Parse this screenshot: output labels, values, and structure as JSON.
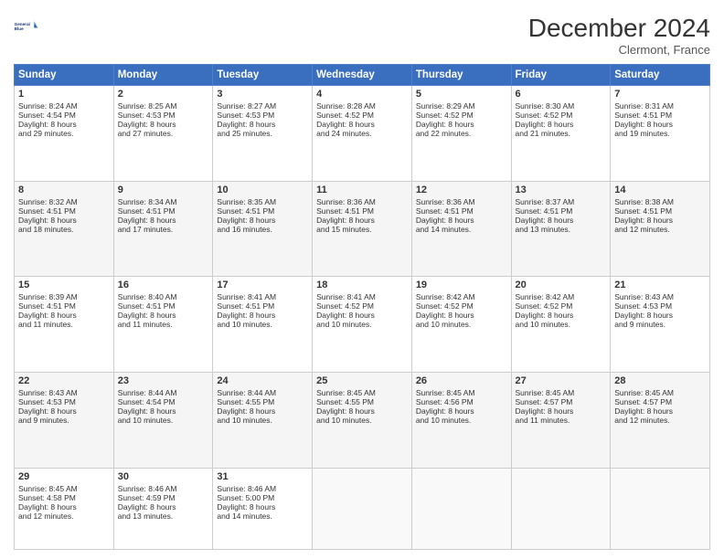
{
  "header": {
    "logo_line1": "General",
    "logo_line2": "Blue",
    "month": "December 2024",
    "location": "Clermont, France"
  },
  "weekdays": [
    "Sunday",
    "Monday",
    "Tuesday",
    "Wednesday",
    "Thursday",
    "Friday",
    "Saturday"
  ],
  "weeks": [
    [
      {
        "day": "1",
        "lines": [
          "Sunrise: 8:24 AM",
          "Sunset: 4:54 PM",
          "Daylight: 8 hours",
          "and 29 minutes."
        ]
      },
      {
        "day": "2",
        "lines": [
          "Sunrise: 8:25 AM",
          "Sunset: 4:53 PM",
          "Daylight: 8 hours",
          "and 27 minutes."
        ]
      },
      {
        "day": "3",
        "lines": [
          "Sunrise: 8:27 AM",
          "Sunset: 4:53 PM",
          "Daylight: 8 hours",
          "and 25 minutes."
        ]
      },
      {
        "day": "4",
        "lines": [
          "Sunrise: 8:28 AM",
          "Sunset: 4:52 PM",
          "Daylight: 8 hours",
          "and 24 minutes."
        ]
      },
      {
        "day": "5",
        "lines": [
          "Sunrise: 8:29 AM",
          "Sunset: 4:52 PM",
          "Daylight: 8 hours",
          "and 22 minutes."
        ]
      },
      {
        "day": "6",
        "lines": [
          "Sunrise: 8:30 AM",
          "Sunset: 4:52 PM",
          "Daylight: 8 hours",
          "and 21 minutes."
        ]
      },
      {
        "day": "7",
        "lines": [
          "Sunrise: 8:31 AM",
          "Sunset: 4:51 PM",
          "Daylight: 8 hours",
          "and 19 minutes."
        ]
      }
    ],
    [
      {
        "day": "8",
        "lines": [
          "Sunrise: 8:32 AM",
          "Sunset: 4:51 PM",
          "Daylight: 8 hours",
          "and 18 minutes."
        ]
      },
      {
        "day": "9",
        "lines": [
          "Sunrise: 8:34 AM",
          "Sunset: 4:51 PM",
          "Daylight: 8 hours",
          "and 17 minutes."
        ]
      },
      {
        "day": "10",
        "lines": [
          "Sunrise: 8:35 AM",
          "Sunset: 4:51 PM",
          "Daylight: 8 hours",
          "and 16 minutes."
        ]
      },
      {
        "day": "11",
        "lines": [
          "Sunrise: 8:36 AM",
          "Sunset: 4:51 PM",
          "Daylight: 8 hours",
          "and 15 minutes."
        ]
      },
      {
        "day": "12",
        "lines": [
          "Sunrise: 8:36 AM",
          "Sunset: 4:51 PM",
          "Daylight: 8 hours",
          "and 14 minutes."
        ]
      },
      {
        "day": "13",
        "lines": [
          "Sunrise: 8:37 AM",
          "Sunset: 4:51 PM",
          "Daylight: 8 hours",
          "and 13 minutes."
        ]
      },
      {
        "day": "14",
        "lines": [
          "Sunrise: 8:38 AM",
          "Sunset: 4:51 PM",
          "Daylight: 8 hours",
          "and 12 minutes."
        ]
      }
    ],
    [
      {
        "day": "15",
        "lines": [
          "Sunrise: 8:39 AM",
          "Sunset: 4:51 PM",
          "Daylight: 8 hours",
          "and 11 minutes."
        ]
      },
      {
        "day": "16",
        "lines": [
          "Sunrise: 8:40 AM",
          "Sunset: 4:51 PM",
          "Daylight: 8 hours",
          "and 11 minutes."
        ]
      },
      {
        "day": "17",
        "lines": [
          "Sunrise: 8:41 AM",
          "Sunset: 4:51 PM",
          "Daylight: 8 hours",
          "and 10 minutes."
        ]
      },
      {
        "day": "18",
        "lines": [
          "Sunrise: 8:41 AM",
          "Sunset: 4:52 PM",
          "Daylight: 8 hours",
          "and 10 minutes."
        ]
      },
      {
        "day": "19",
        "lines": [
          "Sunrise: 8:42 AM",
          "Sunset: 4:52 PM",
          "Daylight: 8 hours",
          "and 10 minutes."
        ]
      },
      {
        "day": "20",
        "lines": [
          "Sunrise: 8:42 AM",
          "Sunset: 4:52 PM",
          "Daylight: 8 hours",
          "and 10 minutes."
        ]
      },
      {
        "day": "21",
        "lines": [
          "Sunrise: 8:43 AM",
          "Sunset: 4:53 PM",
          "Daylight: 8 hours",
          "and 9 minutes."
        ]
      }
    ],
    [
      {
        "day": "22",
        "lines": [
          "Sunrise: 8:43 AM",
          "Sunset: 4:53 PM",
          "Daylight: 8 hours",
          "and 9 minutes."
        ]
      },
      {
        "day": "23",
        "lines": [
          "Sunrise: 8:44 AM",
          "Sunset: 4:54 PM",
          "Daylight: 8 hours",
          "and 10 minutes."
        ]
      },
      {
        "day": "24",
        "lines": [
          "Sunrise: 8:44 AM",
          "Sunset: 4:55 PM",
          "Daylight: 8 hours",
          "and 10 minutes."
        ]
      },
      {
        "day": "25",
        "lines": [
          "Sunrise: 8:45 AM",
          "Sunset: 4:55 PM",
          "Daylight: 8 hours",
          "and 10 minutes."
        ]
      },
      {
        "day": "26",
        "lines": [
          "Sunrise: 8:45 AM",
          "Sunset: 4:56 PM",
          "Daylight: 8 hours",
          "and 10 minutes."
        ]
      },
      {
        "day": "27",
        "lines": [
          "Sunrise: 8:45 AM",
          "Sunset: 4:57 PM",
          "Daylight: 8 hours",
          "and 11 minutes."
        ]
      },
      {
        "day": "28",
        "lines": [
          "Sunrise: 8:45 AM",
          "Sunset: 4:57 PM",
          "Daylight: 8 hours",
          "and 12 minutes."
        ]
      }
    ],
    [
      {
        "day": "29",
        "lines": [
          "Sunrise: 8:45 AM",
          "Sunset: 4:58 PM",
          "Daylight: 8 hours",
          "and 12 minutes."
        ]
      },
      {
        "day": "30",
        "lines": [
          "Sunrise: 8:46 AM",
          "Sunset: 4:59 PM",
          "Daylight: 8 hours",
          "and 13 minutes."
        ]
      },
      {
        "day": "31",
        "lines": [
          "Sunrise: 8:46 AM",
          "Sunset: 5:00 PM",
          "Daylight: 8 hours",
          "and 14 minutes."
        ]
      },
      null,
      null,
      null,
      null
    ]
  ]
}
